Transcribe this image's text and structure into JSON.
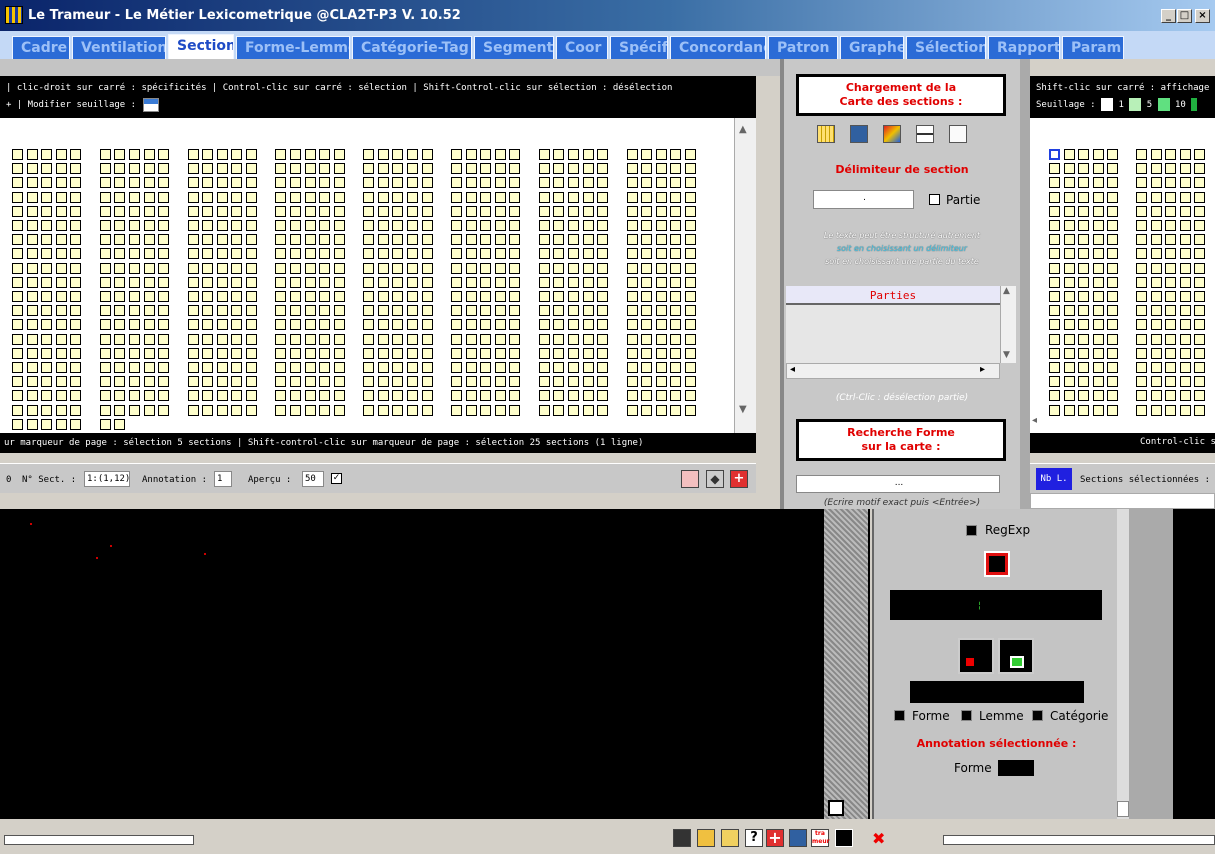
{
  "window": {
    "title": "Le Trameur - Le Métier Lexicometrique @CLA2T-P3 V. 10.52",
    "min": "_",
    "max": "□",
    "close": "×"
  },
  "tabs": [
    {
      "label": "Cadre"
    },
    {
      "label": "Ventilation"
    },
    {
      "label": "Section",
      "active": true
    },
    {
      "label": "Forme-Lemme"
    },
    {
      "label": "Catégorie-Tag"
    },
    {
      "label": "Segment"
    },
    {
      "label": "Coor"
    },
    {
      "label": "Spécif"
    },
    {
      "label": "Concordance"
    },
    {
      "label": "Patron"
    },
    {
      "label": "Graphe"
    },
    {
      "label": "Sélection"
    },
    {
      "label": "Rapport"
    },
    {
      "label": "Param"
    }
  ],
  "left_panel": {
    "hint_top": "| clic-droit sur carré : spécificités | Control-clic sur carré : sélection | Shift-Control-clic sur sélection : désélection",
    "threshold_label": "+ | Modifier seuillage :",
    "hint_bottom": "ur marqueur de page : sélection 5 sections | Shift-control-clic sur marqueur de page : sélection 25 sections (1 ligne)",
    "grid": {
      "full_rows": 19,
      "last_row_squares": 7,
      "squares_per_group": 5,
      "groups_per_row": 8
    },
    "toolbar": {
      "n_prefix": "0",
      "sect_label": "N° Sect. :",
      "sect_value": "1:(1,12)",
      "annotation_label": "Annotation :",
      "annotation_value": "1",
      "apercu_label": "Aperçu :",
      "apercu_value": "50"
    }
  },
  "middle_panel": {
    "load_title_line1": "Chargement de la",
    "load_title_line2": "Carte des sections :",
    "delimiter_label": "Délimiteur de section",
    "delimiter_value": ".",
    "partie_label": "Partie",
    "info_line1": "Le texte peut être structuré autrement",
    "info_line2": "soit en choisissant un délimiteur",
    "info_line3": "soit en choisissant une partie du texte",
    "parties_header": "Parties",
    "deselect_hint": "(Ctrl-Clic : désélection partie)",
    "search_title_line1": "Recherche Forme",
    "search_title_line2": "sur la carte :",
    "search_value": "...",
    "write_hint": "(Ecrire motif exact puis <Entrée>)"
  },
  "right_panel": {
    "hint_top": "Shift-clic sur carré : affichage",
    "threshold_label": "Seuillage :",
    "threshold_values": [
      "1",
      "5",
      "10"
    ],
    "threshold_colors": [
      "#ffffff",
      "#b8f0b8",
      "#60e080",
      "#20b040"
    ],
    "bottom_hint": "Control-clic s",
    "nbl_label": "Nb L.",
    "selected_label": "Sections sélectionnées :"
  },
  "popup": {
    "regexp_label": "RegExp",
    "options": [
      "Forme",
      "Lemme",
      "Catégorie"
    ],
    "annotation_title": "Annotation sélectionnée :",
    "forme_label": "Forme"
  },
  "bottom_icons": [
    "save-icon",
    "folder-icon",
    "open-folder-icon",
    "help-icon",
    "add-icon",
    "edit-icon",
    "trameur-logo-icon",
    "exit-icon"
  ],
  "bottom_logo_text": "tra meur",
  "colors": {
    "title_start": "#0a246a",
    "tab_bg": "#2b6bd6",
    "accent_red": "#e00000",
    "square_fill": "#ffffcc"
  }
}
